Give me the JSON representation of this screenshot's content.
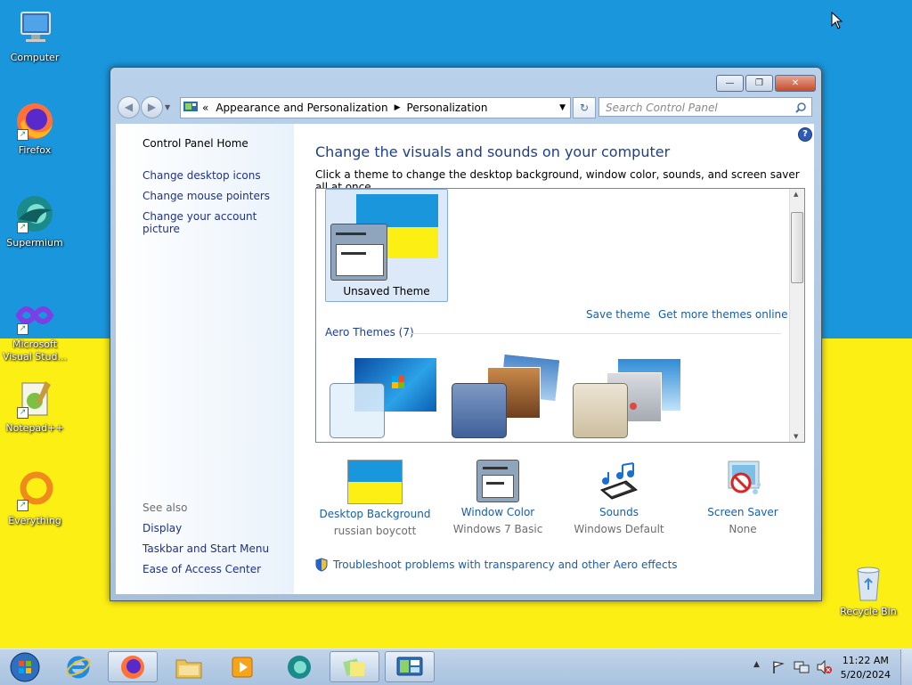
{
  "desktop": {
    "icons": [
      {
        "label": "Computer",
        "icon": "computer-icon"
      },
      {
        "label": "Firefox",
        "icon": "firefox-icon"
      },
      {
        "label": "Supermium",
        "icon": "supermium-icon"
      },
      {
        "label": "Microsoft Visual Stud...",
        "icon": "visual-studio-icon"
      },
      {
        "label": "Notepad++",
        "icon": "notepadpp-icon"
      },
      {
        "label": "Everything",
        "icon": "everything-icon"
      },
      {
        "label": "Recycle Bin",
        "icon": "recycle-bin-icon"
      }
    ],
    "colors": {
      "top": "#1a97dc",
      "bottom": "#fcef14"
    }
  },
  "window": {
    "buttons": {
      "minimize": "—",
      "maximize": "❐",
      "close": "✕"
    },
    "address": {
      "chevrons": "«",
      "crumb1": "Appearance and Personalization",
      "crumb2": "Personalization"
    },
    "search": {
      "placeholder": "Search Control Panel"
    }
  },
  "left_pane": {
    "home": "Control Panel Home",
    "links": [
      "Change desktop icons",
      "Change mouse pointers",
      "Change your account picture"
    ],
    "see_also_heading": "See also",
    "see_also": [
      "Display",
      "Taskbar and Start Menu",
      "Ease of Access Center"
    ]
  },
  "main": {
    "title": "Change the visuals and sounds on your computer",
    "subtitle": "Click a theme to change the desktop background, window color, sounds, and screen saver all at once.",
    "unsaved_theme": "Unsaved Theme",
    "save_theme": "Save theme",
    "more_themes": "Get more themes online",
    "aero_heading": "Aero Themes (7)",
    "bottom_items": [
      {
        "label": "Desktop Background",
        "value": "russian boycott",
        "icon": "desktop-background-icon"
      },
      {
        "label": "Window Color",
        "value": "Windows 7 Basic",
        "icon": "window-color-icon"
      },
      {
        "label": "Sounds",
        "value": "Windows Default",
        "icon": "sounds-icon"
      },
      {
        "label": "Screen Saver",
        "value": "None",
        "icon": "screen-saver-icon"
      }
    ],
    "troubleshoot": "Troubleshoot problems with transparency and other Aero effects"
  },
  "taskbar": {
    "time": "11:22 AM",
    "date": "5/20/2024",
    "pinned": [
      "start-orb",
      "internet-explorer",
      "firefox",
      "file-explorer",
      "media-player",
      "supermium",
      "sticky-notes",
      "control-panel"
    ]
  }
}
